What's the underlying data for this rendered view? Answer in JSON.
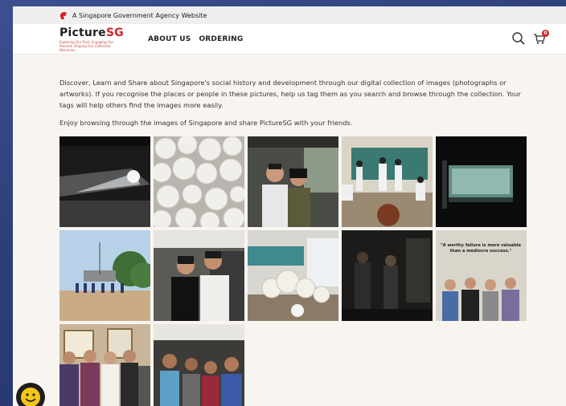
{
  "gov_bar": {
    "text": "A Singapore Government Agency Website",
    "icon": "lion-head-icon"
  },
  "header": {
    "logo": {
      "brand_a": "Picture",
      "brand_b": "SG",
      "tagline": "Exploring Our Past, Engaging Our Present, Shaping Our Collective Memories"
    },
    "nav": [
      {
        "label": "ABOUT US"
      },
      {
        "label": "ORDERING"
      }
    ],
    "icons": {
      "search": "search-icon",
      "cart": "cart-icon",
      "cart_count": "0"
    }
  },
  "main": {
    "intro": "Discover, Learn and Share about Singapore's social history and development through our digital collection of images (photographs or artworks). If you recognise the places or people in these pictures, help us tag them as you search and browse through the collection. Your tags will help others find the images more easily.",
    "enjoy": "Enjoy browsing through the images of Singapore and share PictureSG with your friends.",
    "thumbnails": [
      {
        "desc": "light-beam-in-dark-room"
      },
      {
        "desc": "white-flower-sculptures"
      },
      {
        "desc": "couple-at-exhibition"
      },
      {
        "desc": "classroom-performance"
      },
      {
        "desc": "glowing-display-case"
      },
      {
        "desc": "outdoor-field-event"
      },
      {
        "desc": "couple-at-gallery"
      },
      {
        "desc": "classroom-with-sculptures"
      },
      {
        "desc": "dark-gallery-visitors"
      },
      {
        "desc": "group-in-front-of-quote",
        "quote": "\"A worthy failure is more valuable than a mediocre success.\""
      },
      {
        "desc": "family-group-photo"
      },
      {
        "desc": "friends-group-photo"
      }
    ]
  },
  "chat": {
    "icon": "smiley-chat-icon"
  },
  "colors": {
    "brand_red": "#d4202a",
    "page_bg": "#f8f5f1",
    "outer_bg": "#2e3f78"
  }
}
